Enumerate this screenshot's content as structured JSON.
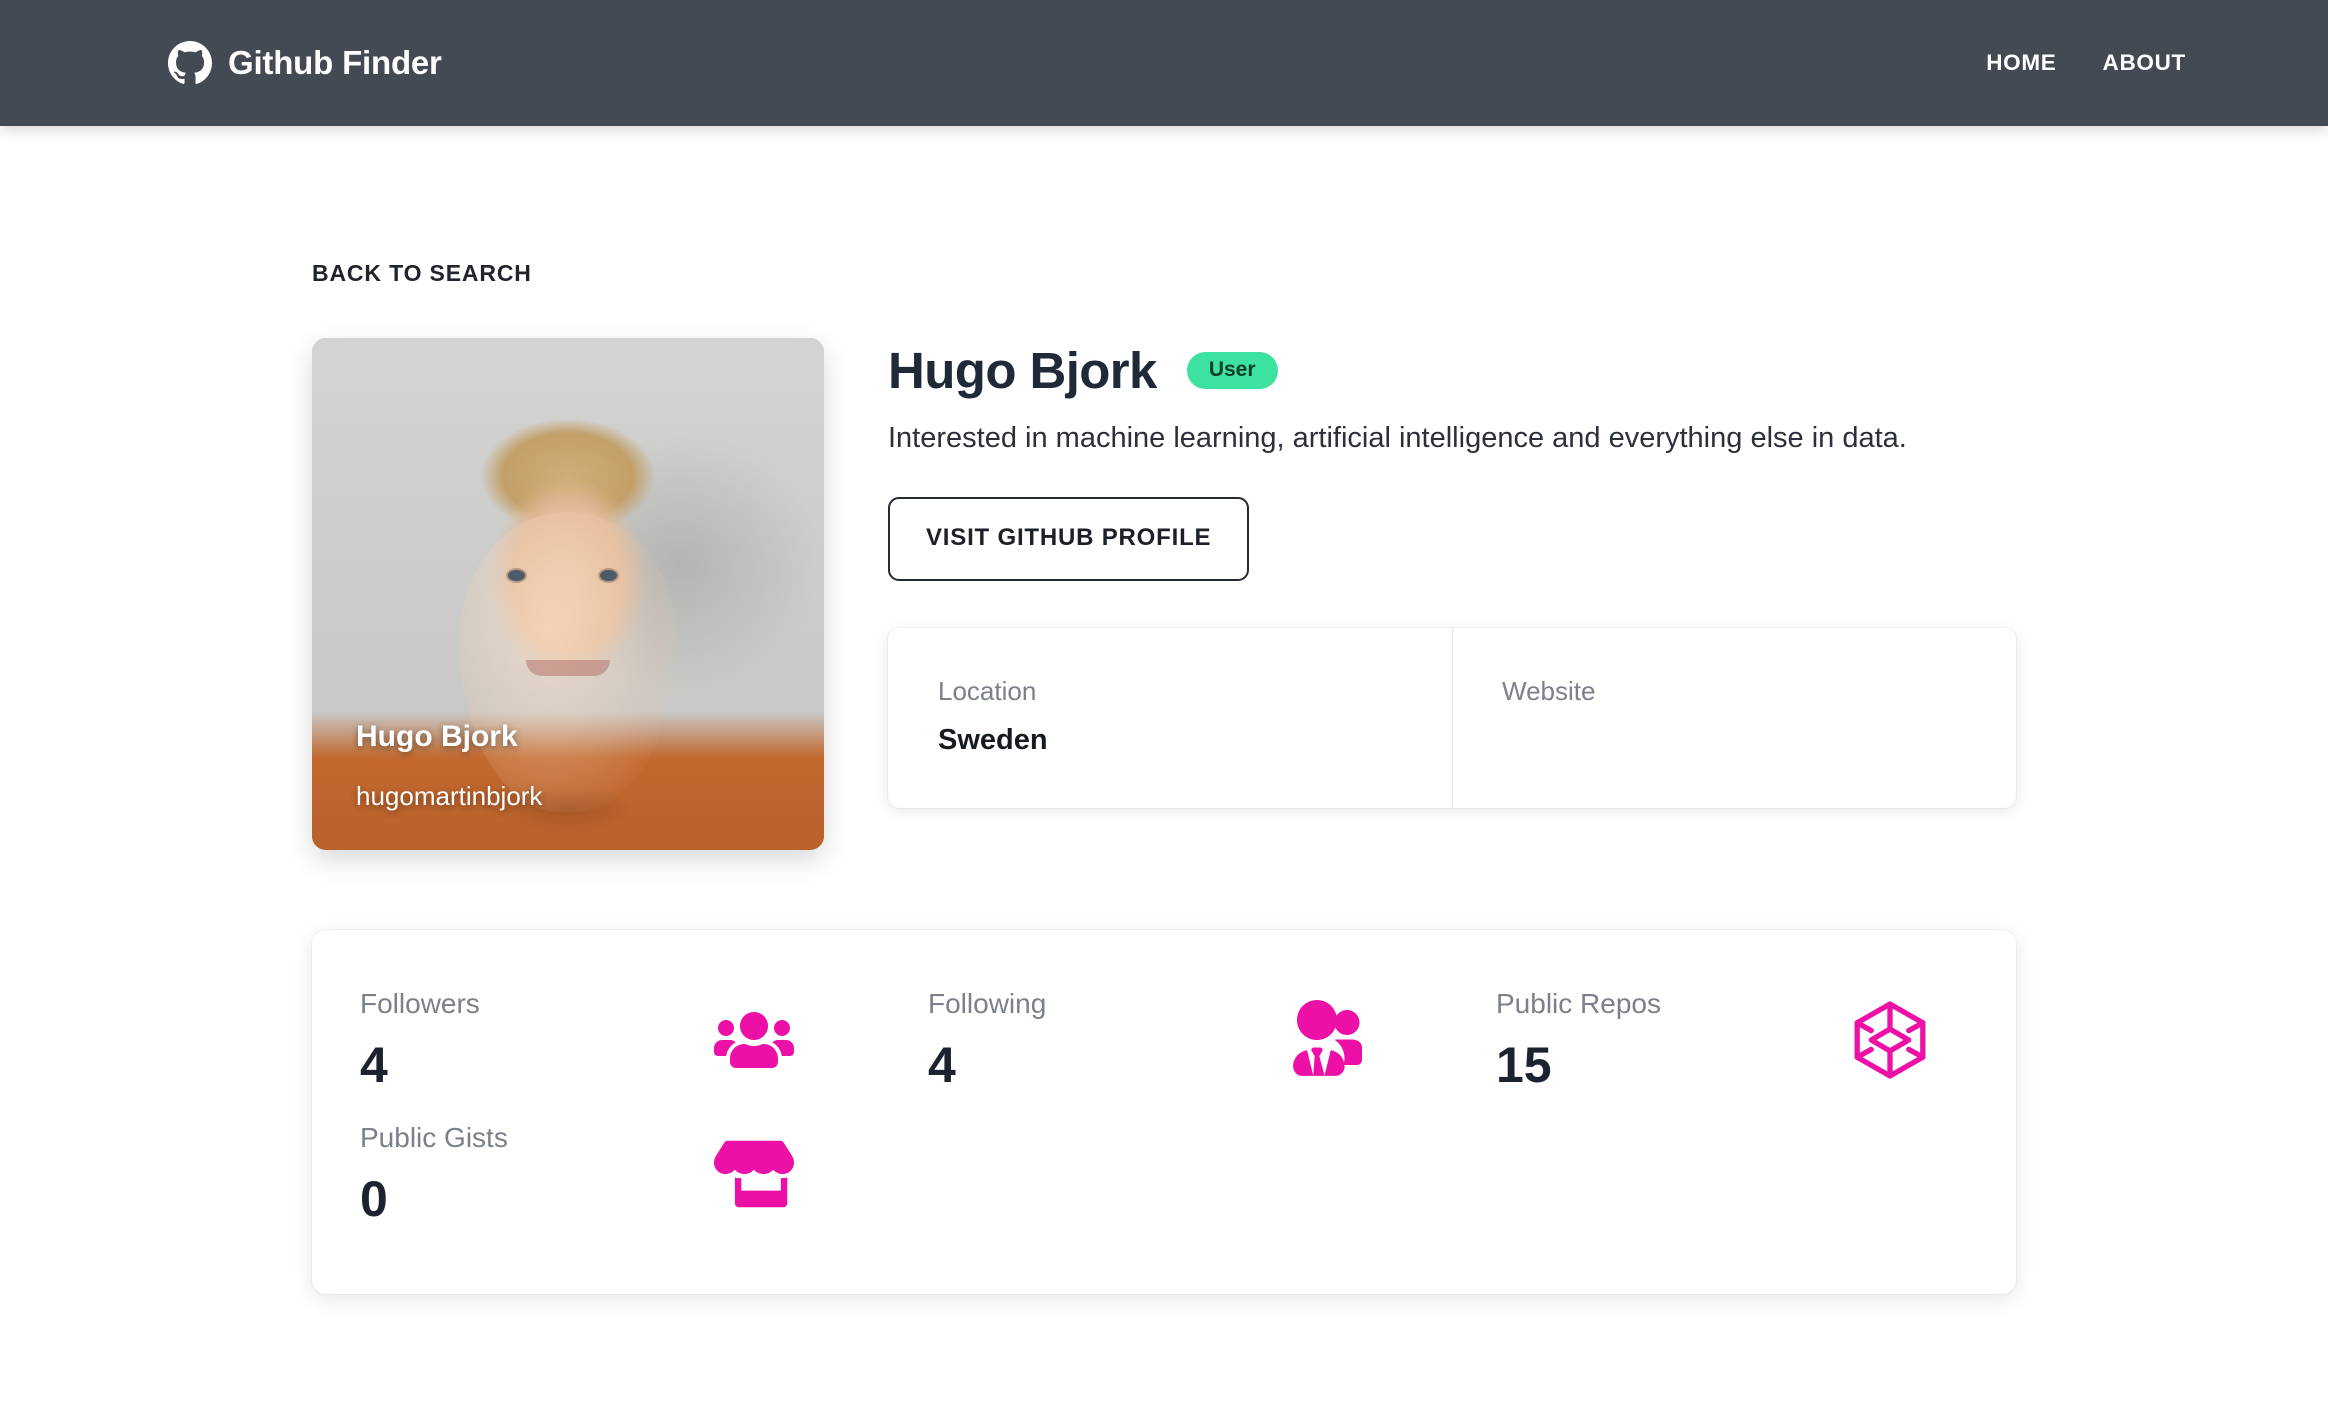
{
  "navbar": {
    "brand": "Github Finder",
    "brand_icon": "github-logo-icon",
    "links": [
      {
        "label": "HOME"
      },
      {
        "label": "ABOUT"
      }
    ]
  },
  "back_link": {
    "label": "BACK TO SEARCH"
  },
  "profile": {
    "avatar": {
      "name": "Hugo Bjork",
      "login": "hugomartinbjork"
    },
    "display_name": "Hugo Bjork",
    "badge": "User",
    "bio": "Interested in machine learning, artificial intelligence and everything else in data.",
    "visit_button": "VISIT GITHUB PROFILE",
    "meta": [
      {
        "label": "Location",
        "value": "Sweden"
      },
      {
        "label": "Website",
        "value": ""
      }
    ]
  },
  "stats": [
    {
      "label": "Followers",
      "value": "4",
      "icon": "users-group-icon"
    },
    {
      "label": "Following",
      "value": "4",
      "icon": "two-users-icon"
    },
    {
      "label": "Public Repos",
      "value": "15",
      "icon": "codepen-box-icon"
    },
    {
      "label": "Public Gists",
      "value": "0",
      "icon": "store-icon"
    }
  ],
  "colors": {
    "navbar_bg": "#434a54",
    "accent_magenta": "#ec10a6",
    "badge_green": "#3ee2a0",
    "text_dark": "#1f2937",
    "text_muted": "#7b808a"
  }
}
